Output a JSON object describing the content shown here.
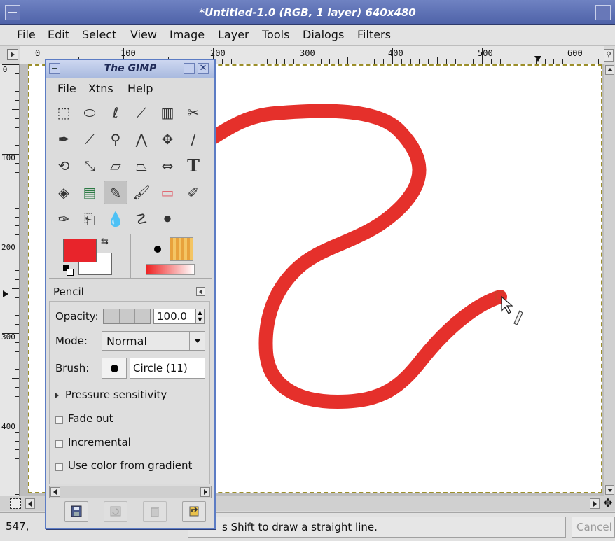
{
  "image_window": {
    "title": "*Untitled-1.0 (RGB, 1 layer) 640x480",
    "menu": [
      "File",
      "Edit",
      "Select",
      "View",
      "Image",
      "Layer",
      "Tools",
      "Dialogs",
      "Filters"
    ],
    "h_ruler_labels": [
      "0",
      "100",
      "200",
      "300",
      "400",
      "500",
      "600"
    ],
    "v_ruler_labels": [
      "0",
      "100",
      "200",
      "300",
      "400"
    ],
    "status": {
      "coords": "547,",
      "message": "s Shift to draw a straight line.",
      "cancel_label": "Cancel"
    },
    "stroke_color": "#e5302b",
    "selection_outline_color": "#9c8f2b"
  },
  "toolbox": {
    "title": "The GIMP",
    "menu": [
      "File",
      "Xtns",
      "Help"
    ],
    "tools": [
      {
        "name": "rect-select-icon",
        "glyph": "⬚"
      },
      {
        "name": "ellipse-select-icon",
        "glyph": "⬭"
      },
      {
        "name": "free-select-icon",
        "glyph": "ℓ"
      },
      {
        "name": "fuzzy-select-icon",
        "glyph": "⟋"
      },
      {
        "name": "select-by-color-icon",
        "glyph": "▥"
      },
      {
        "name": "scissors-select-icon",
        "glyph": "✂"
      },
      {
        "name": "paths-icon",
        "glyph": "✒"
      },
      {
        "name": "color-picker-icon",
        "glyph": "⟋"
      },
      {
        "name": "zoom-icon",
        "glyph": "⚲"
      },
      {
        "name": "measure-icon",
        "glyph": "⋀"
      },
      {
        "name": "move-icon",
        "glyph": "✥"
      },
      {
        "name": "crop-icon",
        "glyph": "∕"
      },
      {
        "name": "rotate-icon",
        "glyph": "⟲"
      },
      {
        "name": "scale-icon",
        "glyph": "⤡"
      },
      {
        "name": "shear-icon",
        "glyph": "▱"
      },
      {
        "name": "perspective-icon",
        "glyph": "⏢"
      },
      {
        "name": "flip-icon",
        "glyph": "⇔"
      },
      {
        "name": "text-icon",
        "glyph": "T"
      },
      {
        "name": "bucket-fill-icon",
        "glyph": "◈"
      },
      {
        "name": "blend-icon",
        "glyph": "▤"
      },
      {
        "name": "pencil-icon",
        "glyph": "✎"
      },
      {
        "name": "paintbrush-icon",
        "glyph": "🖌"
      },
      {
        "name": "eraser-icon",
        "glyph": "▭"
      },
      {
        "name": "airbrush-icon",
        "glyph": "✐"
      },
      {
        "name": "ink-icon",
        "glyph": "✑"
      },
      {
        "name": "clone-icon",
        "glyph": "⎗"
      },
      {
        "name": "blur-sharpen-icon",
        "glyph": "💧"
      },
      {
        "name": "smudge-icon",
        "glyph": "☡"
      },
      {
        "name": "dodge-burn-icon",
        "glyph": "⚫"
      }
    ],
    "colors": {
      "foreground": "#e8242b",
      "background": "#ffffff"
    },
    "tool_options": {
      "title": "Pencil",
      "opacity_label": "Opacity:",
      "opacity_value": "100.0",
      "mode_label": "Mode:",
      "mode_value": "Normal",
      "brush_label": "Brush:",
      "brush_value": "Circle (11)",
      "pressure_label": "Pressure sensitivity",
      "fade_out_label": "Fade out",
      "incremental_label": "Incremental",
      "use_gradient_label": "Use color from gradient"
    },
    "bottom_buttons": [
      "save-options-icon",
      "restore-options-icon",
      "delete-options-icon",
      "reset-options-icon"
    ]
  }
}
